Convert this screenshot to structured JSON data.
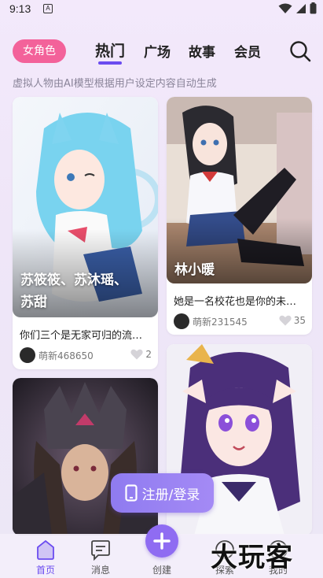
{
  "status_bar": {
    "time": "9:13",
    "notification_letter": "A"
  },
  "header": {
    "role_pill": "女角色",
    "tabs": [
      {
        "label": "热门",
        "active": true
      },
      {
        "label": "广场",
        "active": false
      },
      {
        "label": "故事",
        "active": false
      },
      {
        "label": "会员",
        "active": false
      }
    ],
    "subtitle": "虚拟人物由AI模型根据用户设定内容自动生成"
  },
  "cards": [
    {
      "name_line1": "苏筱筱、苏沐瑶、",
      "name_line2": "苏甜",
      "description": "你们三个是无家可归的流…",
      "author": "萌新468650",
      "likes": "2"
    },
    {
      "name_line1": "林小暖",
      "name_line2": "",
      "description": "她是一名校花也是你的未…",
      "author": "萌新231545",
      "likes": "35"
    },
    {
      "name_line1": "",
      "name_line2": "",
      "description": "",
      "author": "",
      "likes": ""
    },
    {
      "name_line1": "",
      "name_line2": "",
      "description": "",
      "author": "",
      "likes": ""
    }
  ],
  "login_button": {
    "label": "注册/登录"
  },
  "bottom_nav": {
    "items": [
      {
        "label": "首页",
        "active": true
      },
      {
        "label": "消息",
        "active": false
      },
      {
        "label": "创建",
        "active": false
      },
      {
        "label": "探索",
        "active": false
      },
      {
        "label": "我的",
        "active": false
      }
    ]
  },
  "watermark": "大玩客",
  "colors": {
    "accent": "#6b4cf0",
    "pill": "#f3629a",
    "create": "#8f6cf2"
  }
}
